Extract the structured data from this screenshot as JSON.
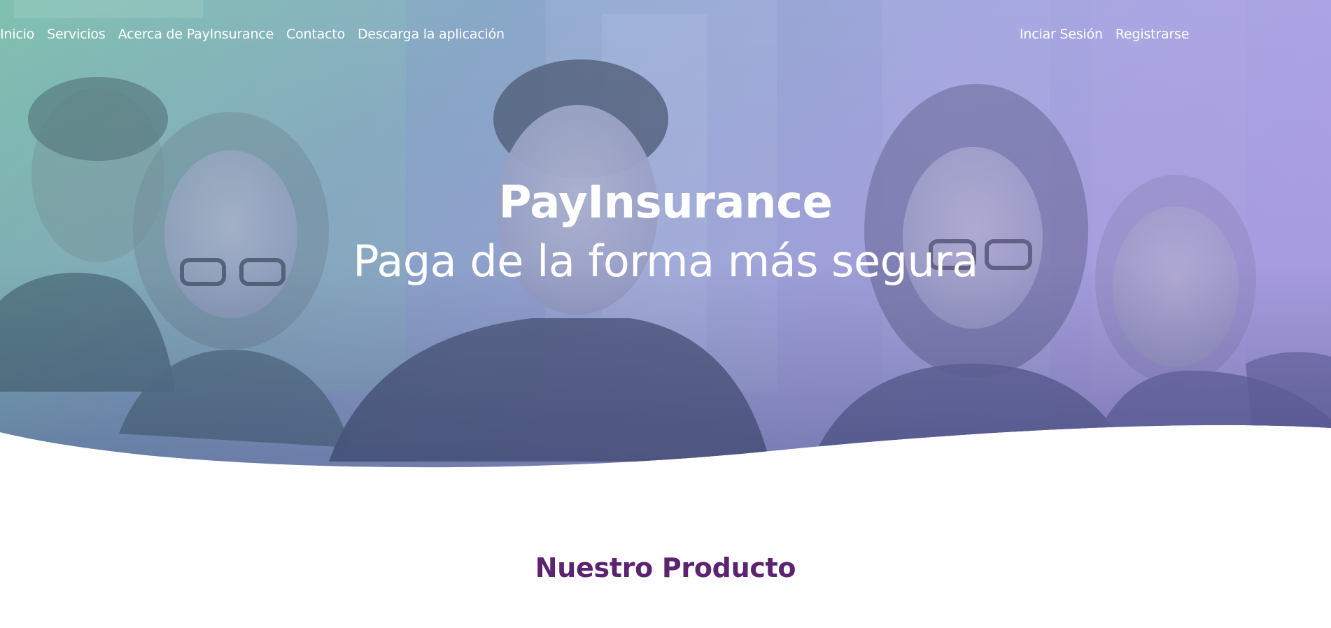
{
  "nav": {
    "left_links": [
      {
        "label": "Inicio"
      },
      {
        "label": "Servicios"
      },
      {
        "label": "Acerca de PayInsurance"
      },
      {
        "label": "Contacto"
      },
      {
        "label": "Descarga la aplicación"
      }
    ],
    "right_links": [
      {
        "label": "Inciar Sesión"
      },
      {
        "label": "Registrarse"
      }
    ]
  },
  "hero": {
    "title": "PayInsurance",
    "subtitle": "Paga de la forma más segura",
    "image": "team-photo",
    "gradient_colors": [
      "#6fb8a8",
      "#7e96c8",
      "#a99ae0"
    ]
  },
  "section": {
    "title": "Nuestro Producto"
  },
  "colors": {
    "accent": "#5b2370",
    "text_on_hero": "#ffffff",
    "background": "#ffffff"
  }
}
